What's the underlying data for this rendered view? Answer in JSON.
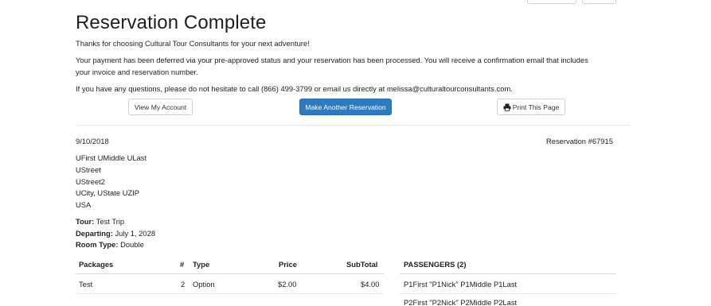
{
  "header": {
    "title": "Reservation Complete"
  },
  "messages": {
    "thanks": "Thanks for choosing Cultural Tour Consultants for your next adventure!",
    "payment_line1": "Your payment has been deferred via your pre-approved status and your reservation has been processed. You will receive a confirmation email that includes",
    "payment_line2": "your invoice and reservation number.",
    "contact": "If you have any questions, please do not hesitate to call (866) 499-3799 or email us directly at melissa@culturaltourconsultants.com."
  },
  "actions": {
    "view_account": "View My Account",
    "make_another": "Make Another Reservation",
    "print_page": "Print This Page",
    "accent_color": "#2f7abf"
  },
  "reservation": {
    "date": "9/10/2018",
    "number_label": "Reservation #67915",
    "address": {
      "name": "UFirst UMiddle ULast",
      "street": "UStreet",
      "street2": "UStreet2",
      "city_line": "UCity, UState  UZIP",
      "country": "USA"
    },
    "tour_label": "Tour:",
    "tour_value": "Test Trip",
    "departing_label": "Departing:",
    "departing_value": "July 1, 2028",
    "room_label": "Room Type:",
    "room_value": "Double"
  },
  "packages_table": {
    "headers": {
      "packages": "Packages",
      "num": "#",
      "type": "Type",
      "price": "Price",
      "subtotal": "SubTotal"
    },
    "rows": [
      {
        "package": "Test",
        "num": "2",
        "type": "Option",
        "price": "$2.00",
        "subtotal": "$4.00"
      }
    ]
  },
  "passengers": {
    "header": "PASSENGERS (2)",
    "list": [
      "P1First \"P1Nick\" P1Middle P1Last",
      "P2First \"P2Nick\" P2Middle P2Last"
    ]
  }
}
